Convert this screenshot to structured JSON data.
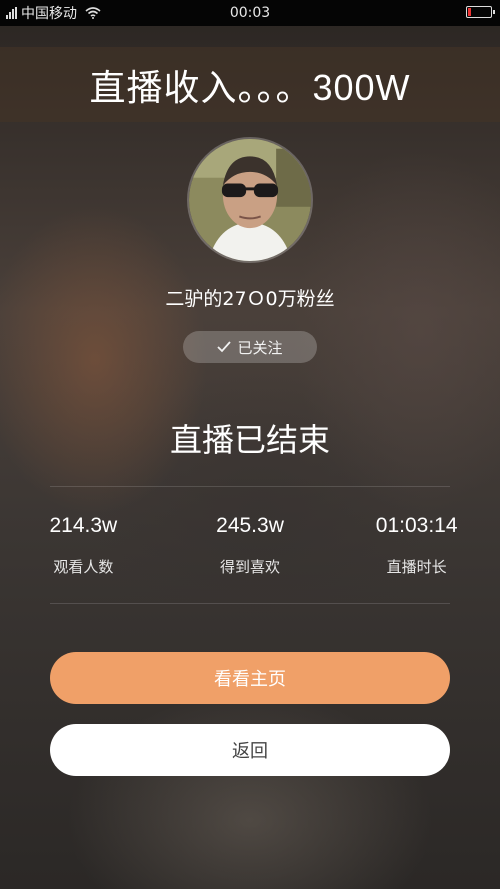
{
  "status_bar": {
    "carrier": "中国移动",
    "time": "00:03",
    "icons": [
      "signal-icon",
      "wifi-icon",
      "battery-icon"
    ],
    "battery_level": 0.15
  },
  "banner": {
    "title": "直播收入。。。300W"
  },
  "profile": {
    "username": "二驴的27Ｏ0万粉丝",
    "follow_label": "已关注"
  },
  "live": {
    "ended_text": "直播已结束",
    "stats": [
      {
        "value": "214.3w",
        "label": "观看人数"
      },
      {
        "value": "245.3w",
        "label": "得到喜欢"
      },
      {
        "value": "01:03:14",
        "label": "直播时长"
      }
    ]
  },
  "actions": {
    "home_label": "看看主页",
    "back_label": "返回"
  },
  "colors": {
    "primary_button": "#f0a068",
    "secondary_button": "#ffffff",
    "battery_low": "#ee3333"
  }
}
